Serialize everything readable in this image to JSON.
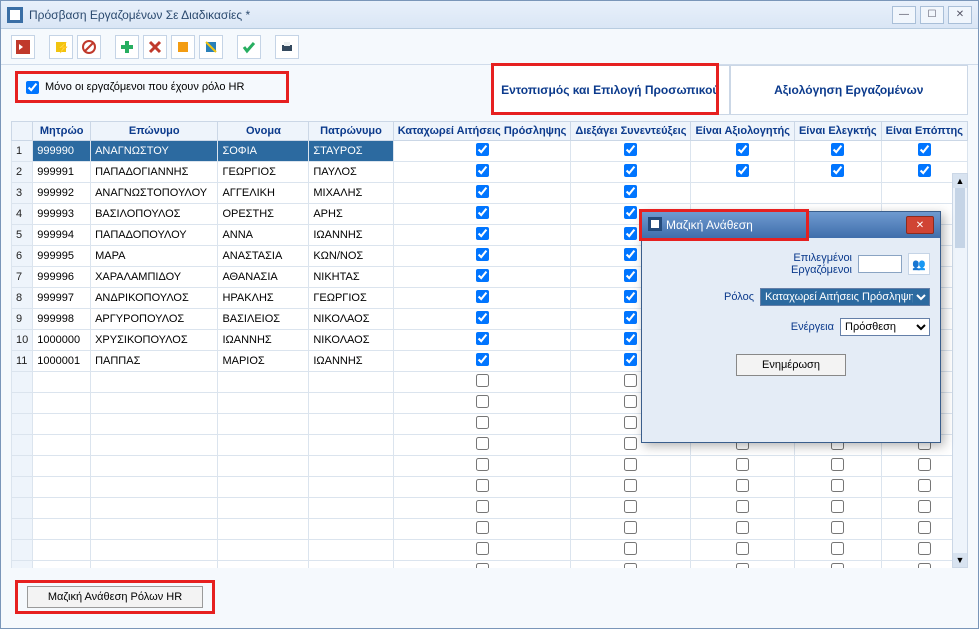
{
  "window": {
    "title": "Πρόσβαση Εργαζομένων Σε Διαδικασίες *"
  },
  "toolbar_icons": [
    "exit",
    "refresh",
    "cancel",
    "add",
    "delete",
    "mark",
    "unmark",
    "check",
    "print"
  ],
  "filter": {
    "label": "Μόνο οι εργαζόμενοι που έχουν ρόλο HR",
    "checked": true
  },
  "tabs": {
    "left": "Εντοπισμός και Επιλογή Προσωπικού",
    "right": "Αξιολόγηση Εργαζομένων"
  },
  "columns": {
    "rownum": "",
    "mitr": "Μητρώο",
    "epon": "Επώνυμο",
    "onoma": "Ονομα",
    "patr": "Πατρώνυμο",
    "c1": "Καταχωρεί Αιτήσεις Πρόσληψης",
    "c2": "Διεξάγει Συνεντεύξεις",
    "c3": "Είναι Αξιολογητής",
    "c4": "Είναι Ελεγκτής",
    "c5": "Είναι Επόπτης"
  },
  "rows": [
    {
      "n": "1",
      "m": "999990",
      "e": "ΑΝΑΓΝΩΣΤΟΥ",
      "o": "ΣΟΦΙΑ",
      "p": "ΣΤΑΥΡΟΣ",
      "sel": true,
      "chk": [
        true,
        true,
        true,
        true,
        true
      ]
    },
    {
      "n": "2",
      "m": "999991",
      "e": "ΠΑΠΑΔΟΓΙΑΝΝΗΣ",
      "o": "ΓΕΩΡΓΙΟΣ",
      "p": "ΠΑΥΛΟΣ",
      "chk": [
        true,
        true,
        true,
        true,
        true
      ]
    },
    {
      "n": "3",
      "m": "999992",
      "e": "ΑΝΑΓΝΩΣΤΟΠΟΥΛΟΥ",
      "o": "ΑΓΓΕΛΙΚΗ",
      "p": "ΜΙΧΑΛΗΣ",
      "chk": [
        true,
        true,
        null,
        null,
        null
      ]
    },
    {
      "n": "4",
      "m": "999993",
      "e": "ΒΑΣΙΛΟΠΟΥΛΟΣ",
      "o": "ΟΡΕΣΤΗΣ",
      "p": "ΑΡΗΣ",
      "chk": [
        true,
        true,
        null,
        null,
        null
      ]
    },
    {
      "n": "5",
      "m": "999994",
      "e": "ΠΑΠΑΔΟΠΟΥΛΟΥ",
      "o": "ΑΝΝΑ",
      "p": "ΙΩΑΝΝΗΣ",
      "chk": [
        true,
        true,
        null,
        null,
        null
      ]
    },
    {
      "n": "6",
      "m": "999995",
      "e": "ΜΑΡΑ",
      "o": "ΑΝΑΣΤΑΣΙΑ",
      "p": "ΚΩΝ/ΝΟΣ",
      "chk": [
        true,
        true,
        null,
        null,
        null
      ]
    },
    {
      "n": "7",
      "m": "999996",
      "e": "ΧΑΡΑΛΑΜΠΙΔΟΥ",
      "o": "ΑΘΑΝΑΣΙΑ",
      "p": "ΝΙΚΗΤΑΣ",
      "chk": [
        true,
        true,
        null,
        null,
        null
      ]
    },
    {
      "n": "8",
      "m": "999997",
      "e": "ΑΝΔΡΙΚΟΠΟΥΛΟΣ",
      "o": "ΗΡΑΚΛΗΣ",
      "p": "ΓΕΩΡΓΙΟΣ",
      "chk": [
        true,
        true,
        null,
        null,
        null
      ]
    },
    {
      "n": "9",
      "m": "999998",
      "e": "ΑΡΓΥΡΟΠΟΥΛΟΣ",
      "o": "ΒΑΣΙΛΕΙΟΣ",
      "p": "ΝΙΚΟΛΑΟΣ",
      "chk": [
        true,
        true,
        null,
        null,
        null
      ]
    },
    {
      "n": "10",
      "m": "1000000",
      "e": "ΧΡΥΣΙΚΟΠΟΥΛΟΣ",
      "o": "ΙΩΑΝΝΗΣ",
      "p": "ΝΙΚΟΛΑΟΣ",
      "chk": [
        true,
        true,
        null,
        null,
        null
      ]
    },
    {
      "n": "11",
      "m": "1000001",
      "e": "ΠΑΠΠΑΣ",
      "o": "ΜΑΡΙΟΣ",
      "p": "ΙΩΑΝΝΗΣ",
      "chk": [
        true,
        true,
        null,
        null,
        null
      ]
    }
  ],
  "empty_rows": 10,
  "footer": {
    "button": "Μαζική Ανάθεση Ρόλων HR"
  },
  "dialog": {
    "title": "Μαζική Ανάθεση",
    "selected_label": "Επιλεγμένοι Εργαζόμενοι",
    "selected_value": "",
    "role_label": "Ρόλος",
    "role_value": "Καταχωρεί Αιτήσεις Πρόσληψης",
    "action_label": "Ενέργεια",
    "action_value": "Πρόσθεση",
    "update_button": "Ενημέρωση"
  }
}
